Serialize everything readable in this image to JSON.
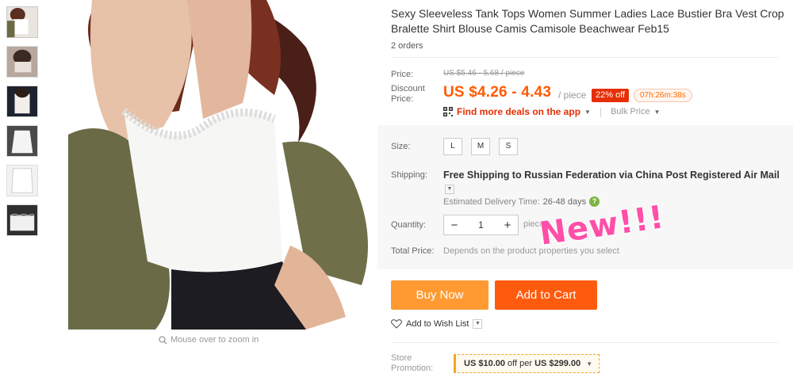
{
  "product": {
    "title": "Sexy Sleeveless Tank Tops Women Summer Ladies Lace Bustier Bra Vest Crop Bralette Shirt Blouse Camis Camisole Beachwear Feb15",
    "orders": "2 orders"
  },
  "gallery": {
    "zoom_hint": "Mouse over to zoom in",
    "thumbnail_count": 6
  },
  "price": {
    "price_label": "Price:",
    "original": "US $5.46 - 5.68 / piece",
    "discount_label_line1": "Discount",
    "discount_label_line2": "Price:",
    "discounted": "US $4.26 - 4.43",
    "per_piece": "/ piece",
    "off_badge": "22% off",
    "timer": "07h:26m:38s",
    "deals_link": "Find more deals on the app",
    "bulk_price": "Bulk Price"
  },
  "size": {
    "label": "Size:",
    "options": [
      "L",
      "M",
      "S"
    ]
  },
  "shipping": {
    "label": "Shipping:",
    "text": "Free Shipping to Russian Federation via China Post Registered Air Mail",
    "delivery_label": "Estimated Delivery Time:",
    "delivery_value": "26-48 days"
  },
  "quantity": {
    "label": "Quantity:",
    "value": "1",
    "minus": "−",
    "plus": "+",
    "note": "piece"
  },
  "total": {
    "label": "Total Price:",
    "note": "Depends on the product properties you select"
  },
  "stamp": "New!!!",
  "actions": {
    "buy_now": "Buy Now",
    "add_to_cart": "Add to Cart",
    "wish_list": "Add to Wish List"
  },
  "promotion": {
    "label_line1": "Store",
    "label_line2": "Promotion:",
    "amount": "US $10.00",
    "middle": "off per",
    "threshold": "US $299.00"
  },
  "colors": {
    "accent_orange": "#ff5a00",
    "off_badge": "#e62e04",
    "buy_now": "#ff9a33",
    "add_to_cart": "#ff5b0f"
  }
}
